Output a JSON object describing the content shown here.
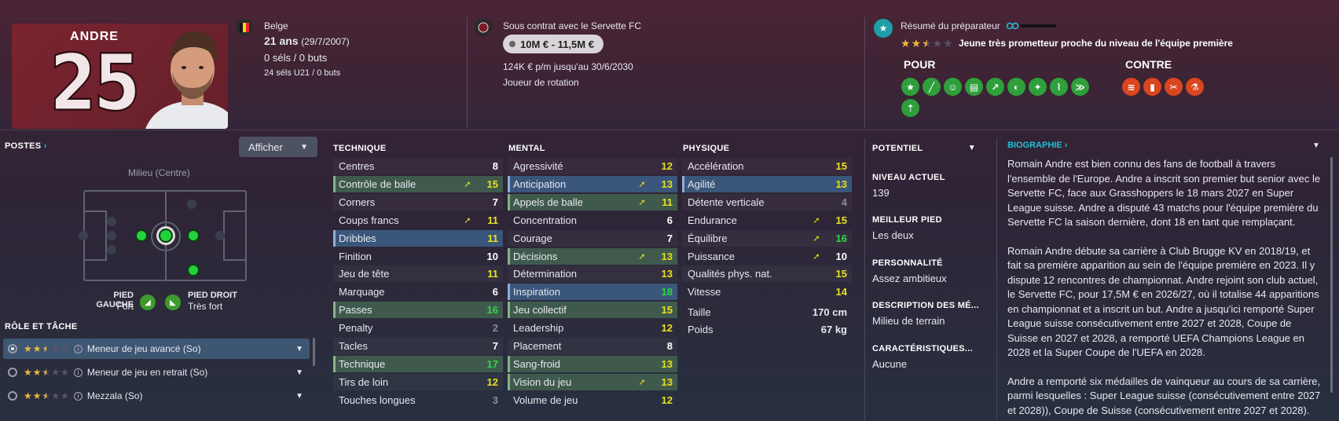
{
  "player": {
    "name": "ANDRE",
    "number": "25",
    "nationality": "Belge",
    "age": "21 ans",
    "dob": "(29/7/2007)",
    "caps": "0 séls / 0 buts",
    "u21caps": "24 séls U21 / 0 buts"
  },
  "contract": {
    "title": "Sous contrat avec le Servette FC",
    "fee": "10M € - 11,5M €",
    "wage": "124K € p/m jusqu'au 30/6/2030",
    "status": "Joueur de rotation"
  },
  "coach": {
    "title": "Résumé du préparateur",
    "stars": 2.5,
    "summary": "Jeune très prometteur proche du niveau de l'équipe première",
    "pros_label": "POUR",
    "cons_label": "CONTRE",
    "pros_icons": [
      "star-icon",
      "tackle-icon",
      "smile-icon",
      "tactic-icon",
      "trend-icon",
      "mind-icon",
      "spark-icon",
      "foot-icon",
      "run-icon",
      "boost-icon"
    ],
    "cons_icons": [
      "stairs-icon",
      "card-icon",
      "cross-icon",
      "flask-icon"
    ]
  },
  "positions": {
    "label": "POSTES",
    "button": "Afficher",
    "position_name": "Milieu (Centre)",
    "left_foot_label": "PIED GAUCHE",
    "left_foot_value": "Fort",
    "right_foot_label": "PIED DROIT",
    "right_foot_value": "Très fort"
  },
  "roles": {
    "label": "RÔLE ET TÂCHE",
    "items": [
      {
        "name": "Meneur de jeu avancé (So)",
        "stars": 2.5,
        "selected": true
      },
      {
        "name": "Meneur de jeu en retrait (So)",
        "stars": 2.5,
        "selected": false
      },
      {
        "name": "Mezzala (So)",
        "stars": 2.5,
        "selected": false
      }
    ]
  },
  "attributes": {
    "technique_label": "TECHNIQUE",
    "mental_label": "MENTAL",
    "physical_label": "PHYSIQUE",
    "technique": [
      {
        "name": "Centres",
        "value": "8",
        "hl": "",
        "arrow": false,
        "color": "w"
      },
      {
        "name": "Contrôle de balle",
        "value": "15",
        "hl": "g",
        "arrow": true,
        "color": "y"
      },
      {
        "name": "Corners",
        "value": "7",
        "hl": "",
        "arrow": false,
        "color": "w"
      },
      {
        "name": "Coups francs",
        "value": "11",
        "hl": "",
        "arrow": true,
        "color": "y"
      },
      {
        "name": "Dribbles",
        "value": "11",
        "hl": "b",
        "arrow": false,
        "color": "y"
      },
      {
        "name": "Finition",
        "value": "10",
        "hl": "",
        "arrow": false,
        "color": "w"
      },
      {
        "name": "Jeu de tête",
        "value": "11",
        "hl": "",
        "arrow": false,
        "color": "y"
      },
      {
        "name": "Marquage",
        "value": "6",
        "hl": "",
        "arrow": false,
        "color": "w"
      },
      {
        "name": "Passes",
        "value": "16",
        "hl": "g",
        "arrow": false,
        "color": "g"
      },
      {
        "name": "Penalty",
        "value": "2",
        "hl": "",
        "arrow": false,
        "color": "gr"
      },
      {
        "name": "Tacles",
        "value": "7",
        "hl": "",
        "arrow": false,
        "color": "w"
      },
      {
        "name": "Technique",
        "value": "17",
        "hl": "g",
        "arrow": false,
        "color": "g"
      },
      {
        "name": "Tirs de loin",
        "value": "12",
        "hl": "",
        "arrow": false,
        "color": "y"
      },
      {
        "name": "Touches longues",
        "value": "3",
        "hl": "",
        "arrow": false,
        "color": "gr"
      }
    ],
    "mental": [
      {
        "name": "Agressivité",
        "value": "12",
        "hl": "",
        "arrow": false,
        "color": "y"
      },
      {
        "name": "Anticipation",
        "value": "13",
        "hl": "b",
        "arrow": true,
        "color": "y"
      },
      {
        "name": "Appels de balle",
        "value": "11",
        "hl": "g",
        "arrow": true,
        "color": "y"
      },
      {
        "name": "Concentration",
        "value": "6",
        "hl": "",
        "arrow": false,
        "color": "w"
      },
      {
        "name": "Courage",
        "value": "7",
        "hl": "",
        "arrow": false,
        "color": "w"
      },
      {
        "name": "Décisions",
        "value": "13",
        "hl": "g",
        "arrow": true,
        "color": "y"
      },
      {
        "name": "Détermination",
        "value": "13",
        "hl": "",
        "arrow": false,
        "color": "y"
      },
      {
        "name": "Inspiration",
        "value": "18",
        "hl": "b",
        "arrow": false,
        "color": "g"
      },
      {
        "name": "Jeu collectif",
        "value": "15",
        "hl": "g",
        "arrow": false,
        "color": "y"
      },
      {
        "name": "Leadership",
        "value": "12",
        "hl": "",
        "arrow": false,
        "color": "y"
      },
      {
        "name": "Placement",
        "value": "8",
        "hl": "",
        "arrow": false,
        "color": "w"
      },
      {
        "name": "Sang-froid",
        "value": "13",
        "hl": "g",
        "arrow": false,
        "color": "y"
      },
      {
        "name": "Vision du jeu",
        "value": "13",
        "hl": "g",
        "arrow": true,
        "color": "y"
      },
      {
        "name": "Volume de jeu",
        "value": "12",
        "hl": "",
        "arrow": false,
        "color": "y"
      }
    ],
    "physical": [
      {
        "name": "Accélération",
        "value": "15",
        "hl": "",
        "arrow": false,
        "color": "y"
      },
      {
        "name": "Agilité",
        "value": "13",
        "hl": "b",
        "arrow": false,
        "color": "y"
      },
      {
        "name": "Détente verticale",
        "value": "4",
        "hl": "",
        "arrow": false,
        "color": "gr"
      },
      {
        "name": "Endurance",
        "value": "15",
        "hl": "",
        "arrow": true,
        "color": "y"
      },
      {
        "name": "Équilibre",
        "value": "16",
        "hl": "",
        "arrow": true,
        "color": "g"
      },
      {
        "name": "Puissance",
        "value": "10",
        "hl": "",
        "arrow": true,
        "color": "w"
      },
      {
        "name": "Qualités phys. nat.",
        "value": "15",
        "hl": "",
        "arrow": false,
        "color": "y"
      },
      {
        "name": "Vitesse",
        "value": "14",
        "hl": "",
        "arrow": false,
        "color": "y"
      }
    ],
    "height_label": "Taille",
    "height": "170 cm",
    "weight_label": "Poids",
    "weight": "67 kg"
  },
  "info": {
    "potential_label": "POTENTIEL",
    "current_label": "NIVEAU ACTUEL",
    "current_value": "139",
    "foot_label": "MEILLEUR PIED",
    "foot_value": "Les deux",
    "personality_label": "PERSONNALITÉ",
    "personality_value": "Assez ambitieux",
    "desc_label": "DESCRIPTION DES MÉ...",
    "desc_value": "Milieu de terrain",
    "char_label": "CARACTÉRISTIQUES...",
    "char_value": "Aucune"
  },
  "bio": {
    "label": "BIOGRAPHIE",
    "p1": "Romain Andre est bien connu des fans de football à travers l'ensemble de l'Europe. Andre a inscrit son premier but senior avec le Servette FC, face aux Grasshoppers le 18 mars 2027 en Super League suisse. Andre a disputé 43 matchs pour l'équipe première du Servette FC la saison dernière, dont 18 en tant que remplaçant.",
    "p2": "Romain Andre débute sa carrière à Club Brugge KV en 2018/19, et fait sa première apparition au sein de l'équipe première en 2023. Il y dispute 12 rencontres de championnat. Andre rejoint son club actuel, le Servette FC, pour 17,5M € en 2026/27, où il totalise 44 apparitions en championnat et a inscrit un but. Andre a jusqu'ici remporté Super League suisse consécutivement entre 2027 et 2028, Coupe de Suisse en 2027 et 2028, a remporté UEFA Champions League en 2028 et la Super Coupe de l'UEFA en 2028.",
    "p3": "Andre a remporté six médailles de vainqueur au cours de sa carrière, parmi lesquelles : Super League suisse (consécutivement entre 2027 et 2028)), Coupe de Suisse (consécutivement entre 2027 et 2028)."
  }
}
